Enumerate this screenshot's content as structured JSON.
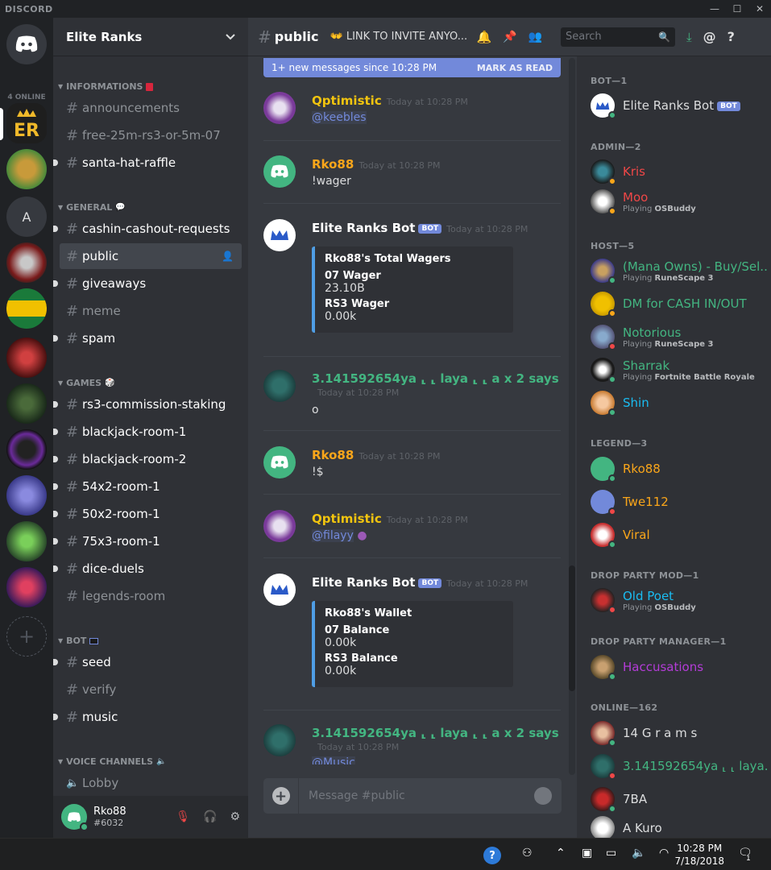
{
  "app": {
    "name": "DISCORD",
    "online_count": "4 ONLINE"
  },
  "server": {
    "name": "Elite Ranks"
  },
  "categories": {
    "informations": "INFORMATIONS",
    "general": "GENERAL",
    "games": "GAMES",
    "bot": "BOT",
    "voice": "VOICE CHANNELS"
  },
  "channels": {
    "announcements": "announcements",
    "free": "free-25m-rs3-or-5m-07",
    "santa": "santa-hat-raffle",
    "cashin": "cashin-cashout-requests",
    "public": "public",
    "giveaways": "giveaways",
    "meme": "meme",
    "spam": "spam",
    "rs3": "rs3-commission-staking",
    "bj1": "blackjack-room-1",
    "bj2": "blackjack-room-2",
    "x54": "54x2-room-1",
    "x50": "50x2-room-1",
    "x75": "75x3-room-1",
    "dice": "dice-duels",
    "legends": "legends-room",
    "seed": "seed",
    "verify": "verify",
    "music": "music",
    "lobby": "Lobby"
  },
  "user": {
    "name": "Rko88",
    "discriminator": "#6032"
  },
  "chat": {
    "channel": "public",
    "topic": "LINK TO INVITE ANYO...",
    "search_placeholder": "Search",
    "banner_text": "1+ new messages since 10:28 PM",
    "banner_action": "MARK AS READ",
    "composer_placeholder": "Message #public"
  },
  "messages": [
    {
      "author": "Qptimistic",
      "time": "Today at 10:28 PM",
      "content": "@keebles"
    },
    {
      "author": "Rko88",
      "time": "Today at 10:28 PM",
      "content": "!wager"
    },
    {
      "author": "Elite Ranks Bot",
      "tag": "BOT",
      "time": "Today at 10:28 PM",
      "embed": {
        "title": "Rko88's Total Wagers",
        "f1": "07 Wager",
        "v1": "23.10B",
        "f2": "RS3 Wager",
        "v2": "0.00k"
      }
    },
    {
      "author": "3.141592654ya ⸤ ⸤ laya ⸤ ⸤ a x 2 says",
      "time": "Today at 10:28 PM",
      "content": "o"
    },
    {
      "author": "Rko88",
      "time": "Today at 10:28 PM",
      "content": "!$"
    },
    {
      "author": "Qptimistic",
      "time": "Today at 10:28 PM",
      "content": "@filayy"
    },
    {
      "author": "Elite Ranks Bot",
      "tag": "BOT",
      "time": "Today at 10:28 PM",
      "embed": {
        "title": "Rko88's Wallet",
        "f1": "07 Balance",
        "v1": "0.00k",
        "f2": "RS3 Balance",
        "v2": "0.00k"
      }
    },
    {
      "author": "3.141592654ya ⸤ ⸤ laya ⸤ ⸤ a x 2 says",
      "time": "Today at 10:28 PM",
      "content": "@Music"
    }
  ],
  "member_groups": {
    "bot": "BOT—1",
    "admin": "ADMIN—2",
    "host": "HOST—5",
    "legend": "LEGEND—3",
    "dpmod": "DROP PARTY MOD—1",
    "dpmgr": "DROP PARTY MANAGER—1",
    "online": "ONLINE—162"
  },
  "members": {
    "elitebot": {
      "name": "Elite Ranks Bot",
      "tag": "BOT"
    },
    "kris": {
      "name": "Kris"
    },
    "moo": {
      "name": "Moo",
      "activity": "Playing",
      "game": "OSBuddy"
    },
    "mana": {
      "name": "(Mana Owns) - Buy/Sel...",
      "activity": "Playing",
      "game": "RuneScape 3"
    },
    "dmcash": {
      "name": "DM for CASH IN/OUT"
    },
    "notorious": {
      "name": "Notorious",
      "activity": "Playing",
      "game": "RuneScape 3"
    },
    "sharrak": {
      "name": "Sharrak",
      "activity": "Playing",
      "game": "Fortnite Battle Royale"
    },
    "shin": {
      "name": "Shin"
    },
    "rko": {
      "name": "Rko88"
    },
    "twe": {
      "name": "Twe112"
    },
    "viral": {
      "name": "Viral"
    },
    "oldpoet": {
      "name": "Old Poet",
      "activity": "Playing",
      "game": "OSBuddy"
    },
    "hacc": {
      "name": "Haccusations"
    },
    "grams": {
      "name": "14 G r a m s"
    },
    "pi": {
      "name": "3.141592654ya ⸤ ⸤ laya..."
    },
    "seven": {
      "name": "7BA"
    },
    "akuro": {
      "name": "A Kuro"
    }
  },
  "colors": {
    "host": "#43b581",
    "admin": "#f04747",
    "legend": "#faa61a",
    "bot_tag": "#7289da",
    "dp_mod": "#1abc9c",
    "dp_mgr": "#9b59b6",
    "online": "#43b581",
    "idle": "#faa61a",
    "dnd": "#f04747"
  },
  "taskbar": {
    "time": "10:28 PM",
    "date": "7/18/2018",
    "notifications": "1"
  }
}
